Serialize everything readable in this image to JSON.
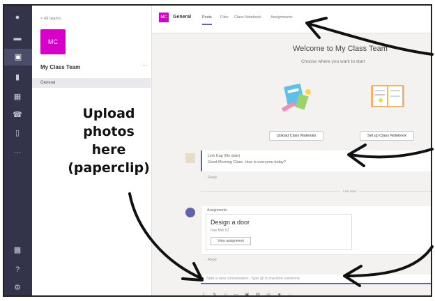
{
  "sidebar": {
    "back_label": "< All teams",
    "team_initials": "MC",
    "team_name": "My Class Team",
    "more_label": "···",
    "channel": "General"
  },
  "header": {
    "channel_initials": "MC",
    "channel_name": "General",
    "tabs": [
      "Posts",
      "Files",
      "Class Notebook",
      "Assignments"
    ]
  },
  "main": {
    "welcome": "Welcome to My Class Team",
    "subtitle": "Choose where you want to start",
    "buttons": [
      "Upload Class Materials",
      "Set up Class Notebook"
    ],
    "message": {
      "sender": "Linh Kag (No date)",
      "text": "Good Morning Class. How is everyone today?",
      "reply": "← Reply"
    },
    "divider": "Last read",
    "assignment": {
      "header": "Assignments",
      "title": "Design a door",
      "due": "Due Mar 10",
      "view_button": "View assignment",
      "reply": "← Reply"
    },
    "compose_placeholder": "Start a new conversation. Type @ to mention someone."
  },
  "annotation": {
    "lines": [
      "Upload",
      "photos",
      "here",
      "(paperclip)"
    ]
  },
  "colors": {
    "rail": "#33344a",
    "brand_magenta": "#d600c9",
    "accent": "#6264a7"
  }
}
